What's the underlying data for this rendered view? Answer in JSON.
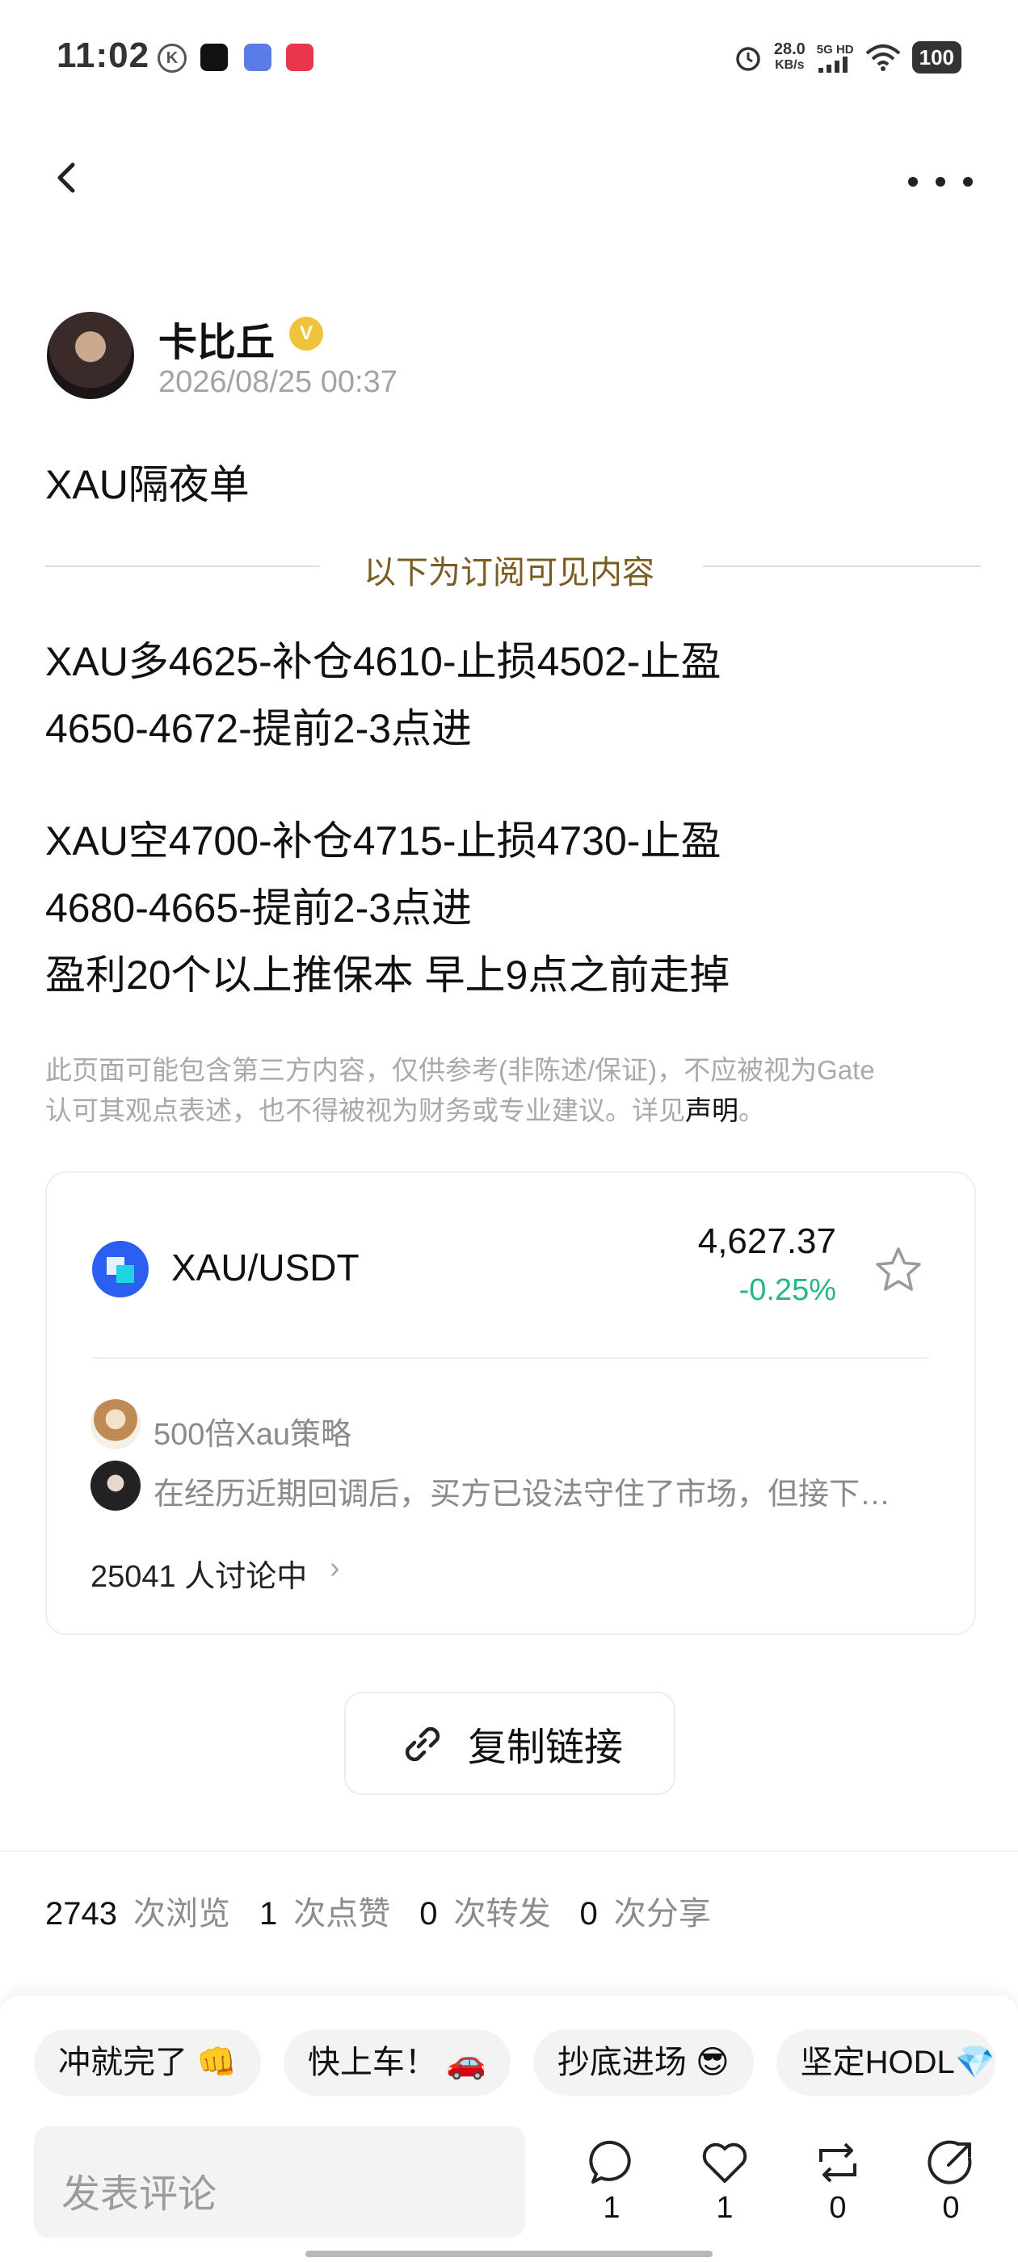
{
  "status_bar": {
    "time": "11:02",
    "k_icon": "K",
    "speed_value": "28.0",
    "speed_unit": "KB/s",
    "network": "5G HD",
    "battery": "100"
  },
  "post": {
    "author": "卡比丘",
    "verified_mark": "V",
    "time": "2026/08/25 00:37",
    "title": "XAU隔夜单",
    "subscriber_divider": "以下为订阅可见内容",
    "body_lines": [
      "XAU多4625-补仓4610-止损4502-止盈",
      "4650-4672-提前2-3点进",
      "",
      "XAU空4700-补仓4715-止损4730-止盈",
      "4680-4665-提前2-3点进",
      "盈利20个以上推保本 早上9点之前走掉"
    ],
    "disclaimer_line1": "此页面可能包含第三方内容，仅供参考(非陈述/保证)，不应被视为Gate",
    "disclaimer_line2": "认可其观点表述，也不得被视为财务或专业建议。详见",
    "disclaimer_link": "声明",
    "disclaimer_end": "。"
  },
  "market_card": {
    "pair": "XAU/USDT",
    "price": "4,627.37",
    "change": "-0.25%",
    "change_color": "#26b587",
    "discussion": {
      "user1": "500倍Xau策略",
      "snippet": "在经历近期回调后，买方已设法守住了市场，但接下…",
      "count": "25041 人讨论中"
    }
  },
  "copy_link_label": "复制链接",
  "stats": {
    "views": "2743",
    "views_label": "次浏览",
    "likes": "1",
    "likes_label": "次点赞",
    "reposts": "0",
    "reposts_label": "次转发",
    "shares": "0",
    "shares_label": "次分享"
  },
  "reactions": [
    "冲就完了 👊",
    "快上车！ 🚗",
    "抄底进场 😎",
    "坚定HODL💎"
  ],
  "comment_placeholder": "发表评论",
  "actions": {
    "comments": "1",
    "likes": "1",
    "reposts": "0",
    "shares": "0"
  }
}
